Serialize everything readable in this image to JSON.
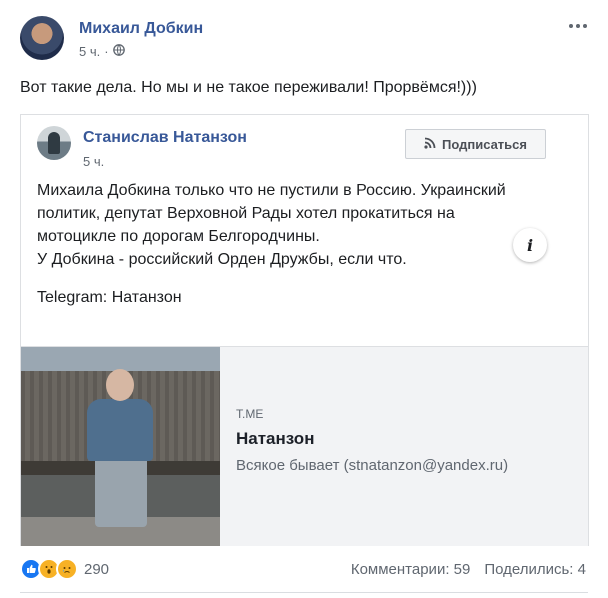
{
  "post": {
    "author": "Михаил Добкин",
    "time": "5 ч.",
    "separator": "·",
    "privacy_icon": "globe-icon",
    "text": "Вот такие дела. Но мы и не такое переживали! Прорвёмся!)))"
  },
  "shared_post": {
    "author": "Станислав Натанзон",
    "time": "5 ч.",
    "subscribe_label": "Подписаться",
    "subscribe_icon": "rss-icon",
    "text_lines": [
      "Михаила Добкина только что не пустили в Россию. Украинский",
      "политик, депутат Верховной Рады хотел прокатиться на",
      "мотоцикле по дорогам Белгородчины.",
      "У Добкина - российский Орден Дружбы, если что."
    ],
    "telegram": "Telegram: Натанзон"
  },
  "link_preview": {
    "domain": "T.ME",
    "title": "Натанзон",
    "description": "Всякое бывает (stnatanzon@yandex.ru)",
    "info_label": "i"
  },
  "footer": {
    "reaction_icons": [
      "like-icon",
      "wow-icon",
      "sad-icon"
    ],
    "reaction_count": "290",
    "comments": "Комментарии: 59",
    "shares": "Поделились: 4"
  },
  "colors": {
    "name_link": "#385898",
    "secondary_text": "#606770",
    "like_blue": "#1877f2",
    "emoji_yellow": "#f7b125"
  }
}
